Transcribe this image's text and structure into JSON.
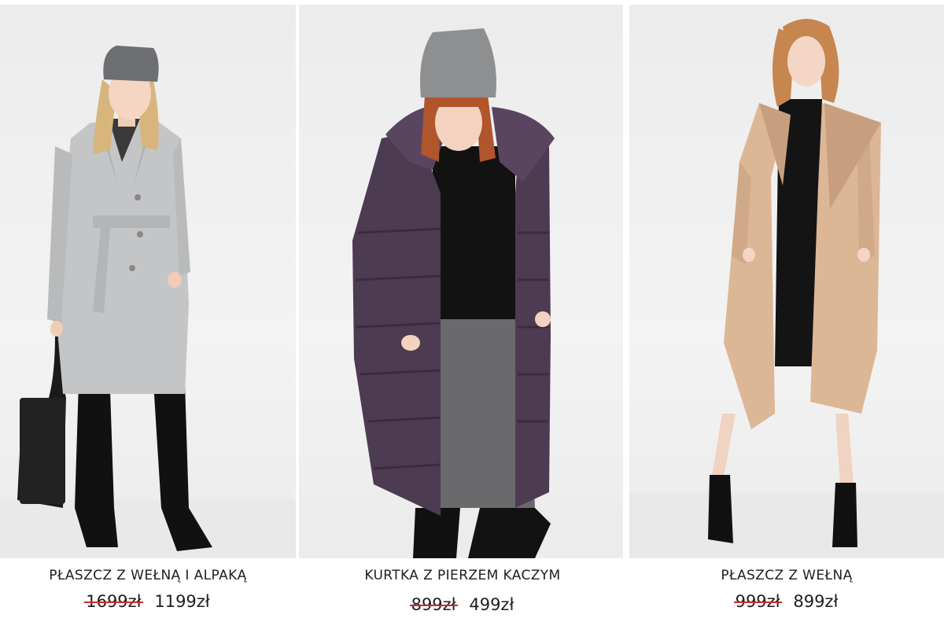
{
  "products": [
    {
      "name": "PŁASZCZ Z WEŁNĄ I ALPAKĄ",
      "old_price": "1699zł",
      "new_price": "1199zł",
      "image": "model-grey-wool-alpaca-coat"
    },
    {
      "name": "KURTKA Z PIERZEM KACZYM",
      "old_price": "899zł",
      "new_price": "499zł",
      "image": "model-purple-down-jacket"
    },
    {
      "name": "PŁASZCZ Z WEŁNĄ",
      "old_price": "999zł",
      "new_price": "899zł",
      "image": "model-camel-wool-coat"
    }
  ],
  "colors": {
    "strike": "#d8262b",
    "text": "#1e1e1e",
    "coat_grey": "#c3c5c7",
    "coat_purple": "#4d3b52",
    "coat_camel": "#dcb796"
  }
}
